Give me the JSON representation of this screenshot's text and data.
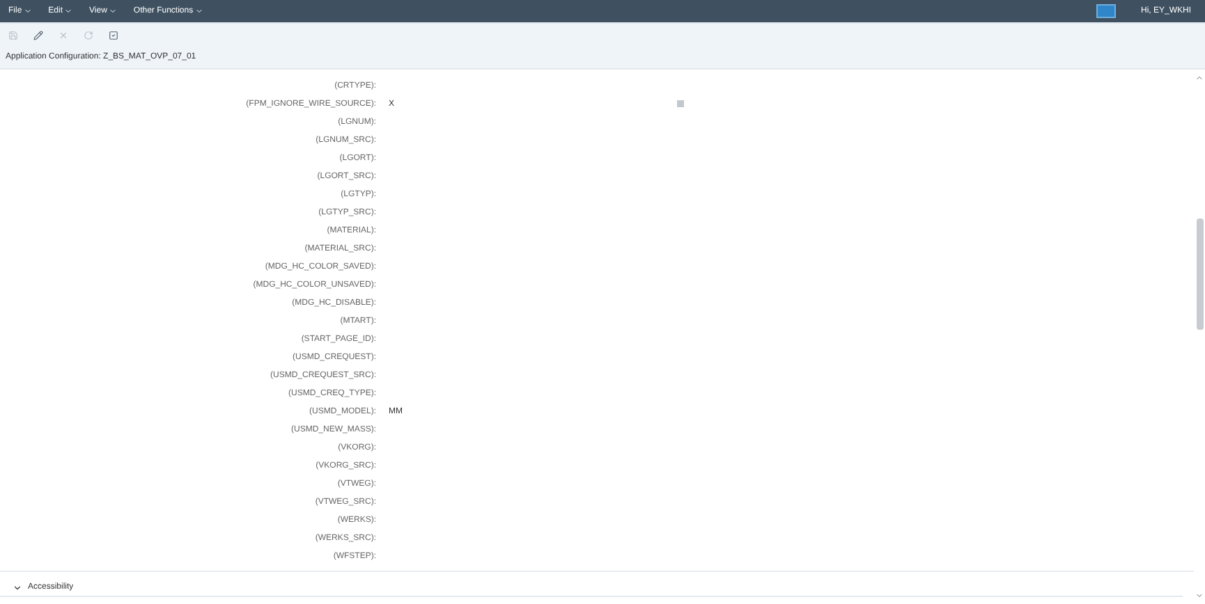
{
  "menu": [
    {
      "label": "File"
    },
    {
      "label": "Edit"
    },
    {
      "label": "View"
    },
    {
      "label": "Other Functions"
    }
  ],
  "user": {
    "greeting": "Hi, EY_WKHI"
  },
  "toolbar": [
    {
      "kind": "save",
      "disabled": true
    },
    {
      "kind": "edit",
      "disabled": false
    },
    {
      "kind": "close",
      "disabled": true
    },
    {
      "kind": "refresh",
      "disabled": true
    },
    {
      "kind": "check",
      "disabled": false
    }
  ],
  "title": "Application Configuration: Z_BS_MAT_OVP_07_01",
  "parameters": [
    {
      "label": "(CRTYPE):"
    },
    {
      "label": "(FPM_IGNORE_WIRE_SOURCE):",
      "value": "X"
    },
    {
      "label": "(LGNUM):"
    },
    {
      "label": "(LGNUM_SRC):"
    },
    {
      "label": "(LGORT):"
    },
    {
      "label": "(LGORT_SRC):"
    },
    {
      "label": "(LGTYP):"
    },
    {
      "label": "(LGTYP_SRC):"
    },
    {
      "label": "(MATERIAL):"
    },
    {
      "label": "(MATERIAL_SRC):"
    },
    {
      "label": "(MDG_HC_COLOR_SAVED):"
    },
    {
      "label": "(MDG_HC_COLOR_UNSAVED):"
    },
    {
      "label": "(MDG_HC_DISABLE):"
    },
    {
      "label": "(MTART):"
    },
    {
      "label": "(START_PAGE_ID):"
    },
    {
      "label": "(USMD_CREQUEST):"
    },
    {
      "label": "(USMD_CREQUEST_SRC):"
    },
    {
      "label": "(USMD_CREQ_TYPE):"
    },
    {
      "label": "(USMD_MODEL):",
      "value": "MM"
    },
    {
      "label": "(USMD_NEW_MASS):"
    },
    {
      "label": "(VKORG):"
    },
    {
      "label": "(VKORG_SRC):"
    },
    {
      "label": "(VTWEG):"
    },
    {
      "label": "(VTWEG_SRC):"
    },
    {
      "label": "(WERKS):"
    },
    {
      "label": "(WERKS_SRC):"
    },
    {
      "label": "(WFSTEP):"
    }
  ],
  "sections": [
    {
      "label": "Accessibility",
      "expanded": true
    }
  ]
}
